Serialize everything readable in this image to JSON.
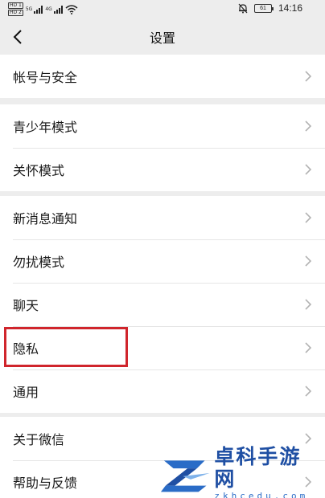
{
  "status_bar": {
    "sim1_tag": "HD 1",
    "sim2_tag": "HD 2",
    "net1": "5G",
    "net2": "4G",
    "battery": "61",
    "time": "14:16"
  },
  "nav": {
    "title": "设置"
  },
  "groups": [
    {
      "items": [
        {
          "label": "帐号与安全"
        }
      ]
    },
    {
      "items": [
        {
          "label": "青少年模式"
        },
        {
          "label": "关怀模式"
        }
      ]
    },
    {
      "items": [
        {
          "label": "新消息通知"
        },
        {
          "label": "勿扰模式"
        },
        {
          "label": "聊天"
        },
        {
          "label": "隐私"
        },
        {
          "label": "通用"
        }
      ]
    },
    {
      "items": [
        {
          "label": "关于微信"
        },
        {
          "label": "帮助与反馈"
        }
      ]
    }
  ],
  "watermark": {
    "title": "卓科手游网",
    "url": "zkhcedu.com"
  },
  "colors": {
    "background": "#ededed",
    "cell": "#ffffff",
    "highlight": "#d0252c",
    "watermark_blue": "#1f4fa3"
  }
}
